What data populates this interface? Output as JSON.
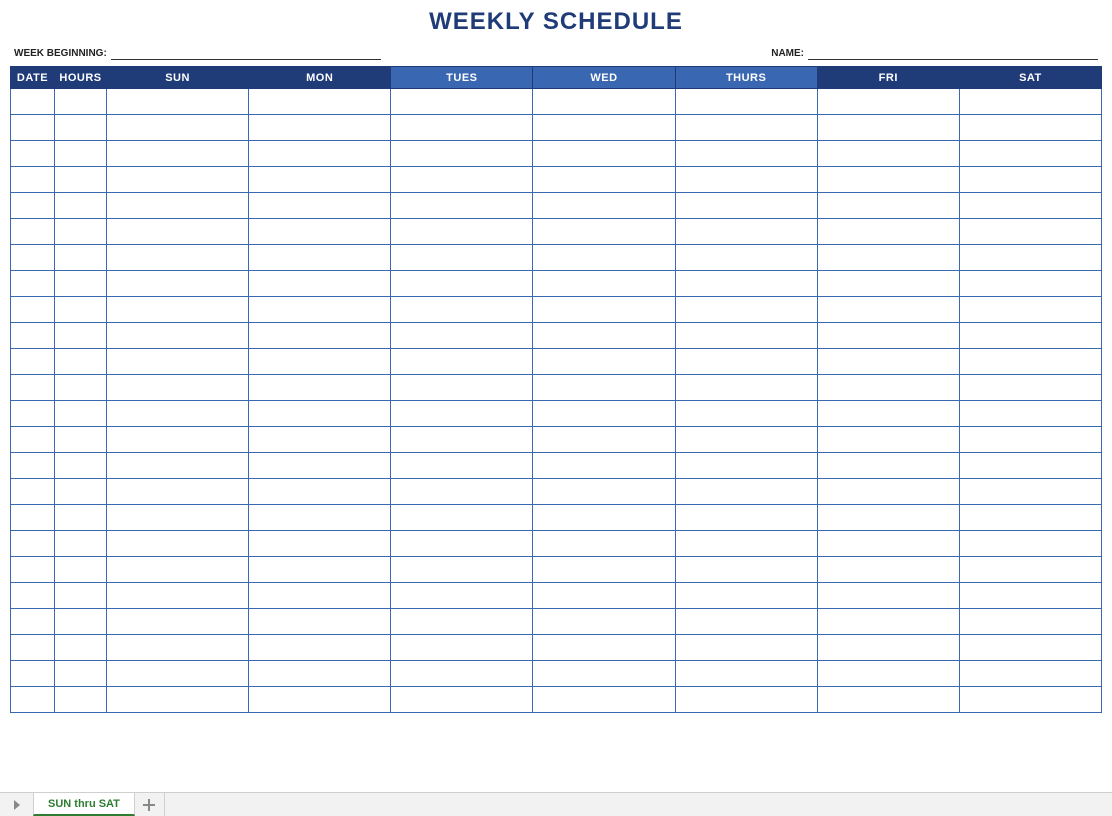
{
  "title": "WEEKLY SCHEDULE",
  "meta": {
    "week_beginning_label": "WEEK BEGINNING:",
    "week_beginning_value": "",
    "name_label": "NAME:",
    "name_value": ""
  },
  "columns": {
    "date": "DATE",
    "hours": "HOURS",
    "sun": "SUN",
    "mon": "MON",
    "tues": "TUES",
    "wed": "WED",
    "thurs": "THURS",
    "fri": "FRI",
    "sat": "SAT"
  },
  "rows": [
    {
      "date": "",
      "hours": "",
      "sun": "",
      "mon": "",
      "tues": "",
      "wed": "",
      "thurs": "",
      "fri": "",
      "sat": ""
    },
    {
      "date": "",
      "hours": "",
      "sun": "",
      "mon": "",
      "tues": "",
      "wed": "",
      "thurs": "",
      "fri": "",
      "sat": ""
    },
    {
      "date": "",
      "hours": "",
      "sun": "",
      "mon": "",
      "tues": "",
      "wed": "",
      "thurs": "",
      "fri": "",
      "sat": ""
    },
    {
      "date": "",
      "hours": "",
      "sun": "",
      "mon": "",
      "tues": "",
      "wed": "",
      "thurs": "",
      "fri": "",
      "sat": ""
    },
    {
      "date": "",
      "hours": "",
      "sun": "",
      "mon": "",
      "tues": "",
      "wed": "",
      "thurs": "",
      "fri": "",
      "sat": ""
    },
    {
      "date": "",
      "hours": "",
      "sun": "",
      "mon": "",
      "tues": "",
      "wed": "",
      "thurs": "",
      "fri": "",
      "sat": ""
    },
    {
      "date": "",
      "hours": "",
      "sun": "",
      "mon": "",
      "tues": "",
      "wed": "",
      "thurs": "",
      "fri": "",
      "sat": ""
    },
    {
      "date": "",
      "hours": "",
      "sun": "",
      "mon": "",
      "tues": "",
      "wed": "",
      "thurs": "",
      "fri": "",
      "sat": ""
    },
    {
      "date": "",
      "hours": "",
      "sun": "",
      "mon": "",
      "tues": "",
      "wed": "",
      "thurs": "",
      "fri": "",
      "sat": ""
    },
    {
      "date": "",
      "hours": "",
      "sun": "",
      "mon": "",
      "tues": "",
      "wed": "",
      "thurs": "",
      "fri": "",
      "sat": ""
    },
    {
      "date": "",
      "hours": "",
      "sun": "",
      "mon": "",
      "tues": "",
      "wed": "",
      "thurs": "",
      "fri": "",
      "sat": ""
    },
    {
      "date": "",
      "hours": "",
      "sun": "",
      "mon": "",
      "tues": "",
      "wed": "",
      "thurs": "",
      "fri": "",
      "sat": ""
    },
    {
      "date": "",
      "hours": "",
      "sun": "",
      "mon": "",
      "tues": "",
      "wed": "",
      "thurs": "",
      "fri": "",
      "sat": ""
    },
    {
      "date": "",
      "hours": "",
      "sun": "",
      "mon": "",
      "tues": "",
      "wed": "",
      "thurs": "",
      "fri": "",
      "sat": ""
    },
    {
      "date": "",
      "hours": "",
      "sun": "",
      "mon": "",
      "tues": "",
      "wed": "",
      "thurs": "",
      "fri": "",
      "sat": ""
    },
    {
      "date": "",
      "hours": "",
      "sun": "",
      "mon": "",
      "tues": "",
      "wed": "",
      "thurs": "",
      "fri": "",
      "sat": ""
    },
    {
      "date": "",
      "hours": "",
      "sun": "",
      "mon": "",
      "tues": "",
      "wed": "",
      "thurs": "",
      "fri": "",
      "sat": ""
    },
    {
      "date": "",
      "hours": "",
      "sun": "",
      "mon": "",
      "tues": "",
      "wed": "",
      "thurs": "",
      "fri": "",
      "sat": ""
    },
    {
      "date": "",
      "hours": "",
      "sun": "",
      "mon": "",
      "tues": "",
      "wed": "",
      "thurs": "",
      "fri": "",
      "sat": ""
    },
    {
      "date": "",
      "hours": "",
      "sun": "",
      "mon": "",
      "tues": "",
      "wed": "",
      "thurs": "",
      "fri": "",
      "sat": ""
    },
    {
      "date": "",
      "hours": "",
      "sun": "",
      "mon": "",
      "tues": "",
      "wed": "",
      "thurs": "",
      "fri": "",
      "sat": ""
    },
    {
      "date": "",
      "hours": "",
      "sun": "",
      "mon": "",
      "tues": "",
      "wed": "",
      "thurs": "",
      "fri": "",
      "sat": ""
    },
    {
      "date": "",
      "hours": "",
      "sun": "",
      "mon": "",
      "tues": "",
      "wed": "",
      "thurs": "",
      "fri": "",
      "sat": ""
    },
    {
      "date": "",
      "hours": "",
      "sun": "",
      "mon": "",
      "tues": "",
      "wed": "",
      "thurs": "",
      "fri": "",
      "sat": ""
    }
  ],
  "sheet_tab": {
    "active": "SUN thru SAT"
  },
  "colors": {
    "header_dark": "#1f3c78",
    "header_mid": "#3a67b1",
    "tab_accent": "#2e7d32"
  }
}
